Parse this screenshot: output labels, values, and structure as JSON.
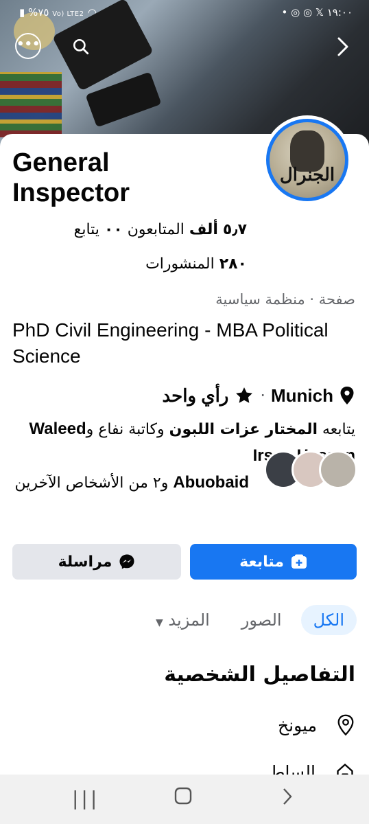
{
  "status_bar": {
    "left_text": "%٧٥",
    "right_text": "١٩:٠٠",
    "network": "Vo) LTE2"
  },
  "cover": {
    "description_colors": [
      "#6f7f8c",
      "#1c1e21"
    ]
  },
  "profile": {
    "name_line1": "General",
    "name_line2": "Inspector",
    "avatar_text": "الجنرال",
    "followers_count": "٥٫٧",
    "followers_unit": "ألف",
    "followers_label": "المتابعون",
    "following_count": "٠٠",
    "following_label": "يتابع",
    "posts_count": "٢٨٠",
    "posts_label": "المنشورات",
    "category": "صفحة · منظمة سياسية",
    "bio": "PhD Civil Engineering - MBA Political Science",
    "location": "Munich",
    "rating": "رأي واحد"
  },
  "followed_by": {
    "prefix": "يتابعه",
    "name1": "المختار عزات اللبون",
    "connector1": "وكاتبة نفاع و",
    "name2": "Waleed Irsan Hassan",
    "name3": "Abuobaid",
    "suffix": "و٢ من الأشخاص الآخرين"
  },
  "actions": {
    "follow_label": "متابعة",
    "message_label": "مراسلة"
  },
  "tabs": [
    {
      "label": "الكل",
      "active": true
    },
    {
      "label": "الصور",
      "active": false
    },
    {
      "label": "المزيد",
      "active": false
    }
  ],
  "details": {
    "title": "التفاصيل الشخصية",
    "rows": [
      {
        "icon": "location-pin-icon",
        "text": "ميونخ"
      },
      {
        "icon": "home-icon",
        "text": "الساط"
      }
    ]
  },
  "colors": {
    "brand": "#1877f2",
    "secondary_btn": "#e4e6eb",
    "muted_text": "#65676b"
  }
}
